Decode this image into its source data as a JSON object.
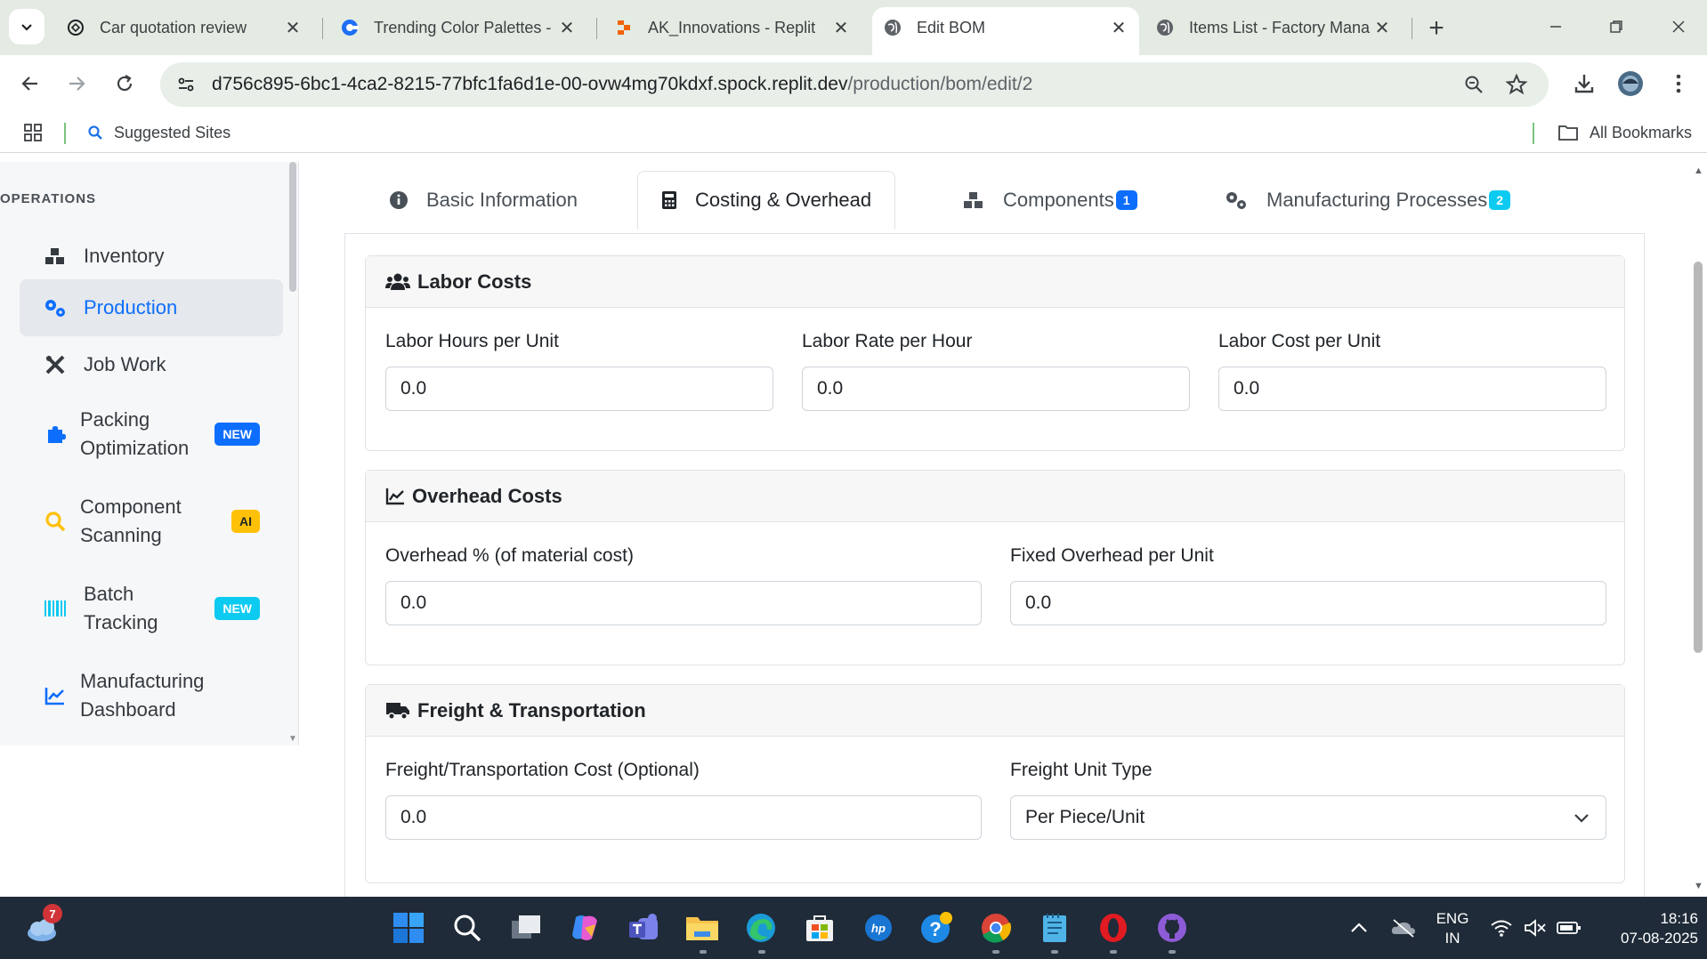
{
  "browser": {
    "tabs": [
      {
        "title": "Car quotation review",
        "favicon": "openai-icon"
      },
      {
        "title": "Trending Color Palettes -",
        "favicon": "coolors-icon"
      },
      {
        "title": "AK_Innovations - Replit",
        "favicon": "replit-icon"
      },
      {
        "title": "Edit BOM",
        "favicon": "globe-icon",
        "active": true
      },
      {
        "title": "Items List - Factory Mana",
        "favicon": "globe-icon"
      }
    ],
    "url_host": "d756c895-6bc1-4ca2-8215-77bfc1fa6d1e-00-ovw4mg70kdxf.spock.replit.dev",
    "url_path": "/production/bom/edit/2",
    "bookmarks": {
      "suggested": "Suggested Sites",
      "all": "All Bookmarks"
    }
  },
  "sidebar": {
    "heading": "OPERATIONS",
    "items": [
      {
        "label": "Inventory",
        "icon": "boxes-icon"
      },
      {
        "label": "Production",
        "icon": "cogs-icon",
        "active": true
      },
      {
        "label": "Job Work",
        "icon": "tools-icon"
      },
      {
        "label": "Packing Optimization",
        "line1": "Packing",
        "line2": "Optimization",
        "icon": "puzzle-icon",
        "badge": "NEW"
      },
      {
        "label": "Component Scanning",
        "line1": "Component",
        "line2": "Scanning",
        "icon": "search-icon",
        "badge": "AI"
      },
      {
        "label": "Batch Tracking",
        "line1": "Batch",
        "line2": "Tracking",
        "icon": "barcode-icon",
        "badge": "NEW"
      },
      {
        "label": "Manufacturing Dashboard",
        "line1": "Manufacturing",
        "line2": "Dashboard",
        "icon": "chart-line-icon"
      }
    ]
  },
  "main": {
    "tabs": [
      {
        "label": "Basic Information",
        "icon": "info-icon"
      },
      {
        "label": "Costing & Overhead",
        "icon": "calculator-icon",
        "active": true
      },
      {
        "label": "Components",
        "icon": "boxes-icon",
        "count": "1"
      },
      {
        "label": "Manufacturing Processes",
        "icon": "cogs-icon",
        "count": "2"
      }
    ],
    "labor": {
      "title": "Labor Costs",
      "hours_label": "Labor Hours per Unit",
      "hours_value": "0.0",
      "rate_label": "Labor Rate per Hour",
      "rate_value": "0.0",
      "cost_label": "Labor Cost per Unit",
      "cost_value": "0.0"
    },
    "overhead": {
      "title": "Overhead Costs",
      "pct_label": "Overhead % (of material cost)",
      "pct_value": "0.0",
      "fixed_label": "Fixed Overhead per Unit",
      "fixed_value": "0.0"
    },
    "freight": {
      "title": "Freight & Transportation",
      "cost_label": "Freight/Transportation Cost (Optional)",
      "cost_value": "0.0",
      "unit_label": "Freight Unit Type",
      "unit_value": "Per Piece/Unit"
    }
  },
  "taskbar": {
    "weather_badge": "7",
    "lang_line1": "ENG",
    "lang_line2": "IN",
    "time": "18:16",
    "date": "07-08-2025"
  },
  "colors": {
    "primary": "#0d6efd",
    "info": "#0dcaf0",
    "warning": "#ffc107",
    "chrome_bg": "#e3ebe2",
    "taskbar": "#1f2b38"
  }
}
